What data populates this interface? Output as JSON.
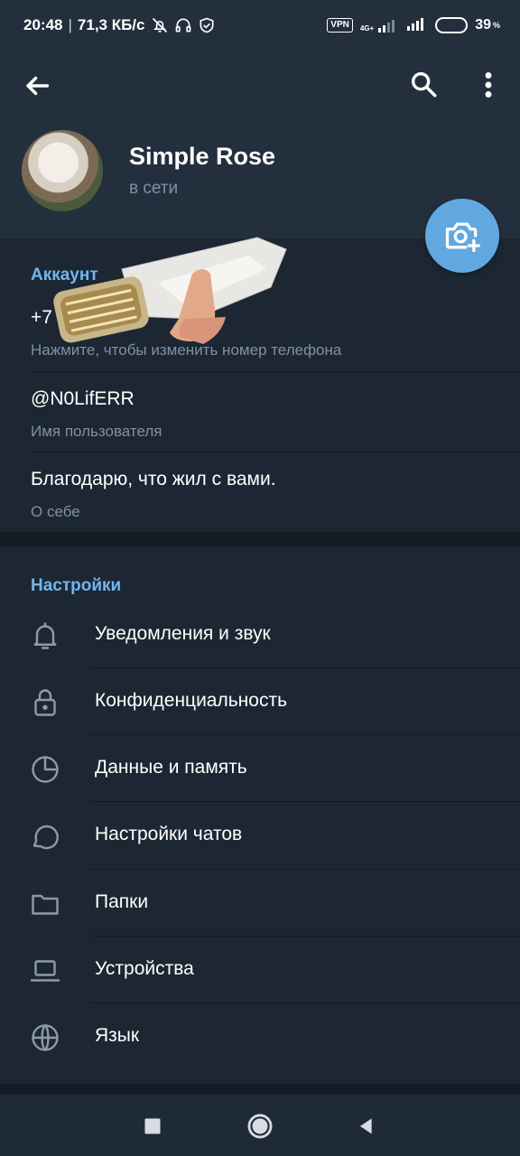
{
  "status_bar": {
    "time": "20:48",
    "speed": "71,3 КБ/с",
    "vpn": "VPN",
    "network": "4G+",
    "battery_percent": "39",
    "battery_level": 0.39,
    "battery_color": "#f2b233",
    "icons": [
      "bell-off-icon",
      "headphones-icon",
      "shield-check-icon",
      "signal-icon",
      "battery-icon"
    ]
  },
  "header": {
    "name": "Simple Rose",
    "status": "в сети",
    "icons": [
      "back-arrow-icon",
      "search-icon",
      "more-vertical-icon",
      "camera-add-icon"
    ]
  },
  "account": {
    "title": "Аккаунт",
    "phone": "+7",
    "phone_hint": "Нажмите, чтобы изменить номер телефона",
    "username": "@N0LifERR",
    "username_hint": "Имя пользователя",
    "bio": "Благодарю, что жил с вами.",
    "bio_hint": "О себе"
  },
  "settings": {
    "title": "Настройки",
    "items": [
      {
        "label": "Уведомления и звук",
        "icon": "bell-icon"
      },
      {
        "label": "Конфиденциальность",
        "icon": "lock-icon"
      },
      {
        "label": "Данные и память",
        "icon": "pie-chart-icon"
      },
      {
        "label": "Настройки чатов",
        "icon": "chat-bubble-icon"
      },
      {
        "label": "Папки",
        "icon": "folder-icon"
      },
      {
        "label": "Устройства",
        "icon": "laptop-icon"
      },
      {
        "label": "Язык",
        "icon": "globe-icon"
      }
    ]
  },
  "nav": {
    "icons": [
      "recents-square-icon",
      "home-circle-icon",
      "back-triangle-icon"
    ]
  },
  "colors": {
    "accent": "#70b5ee",
    "fab": "#62a8e0",
    "background": "#1b2431",
    "header": "#242f3d"
  }
}
